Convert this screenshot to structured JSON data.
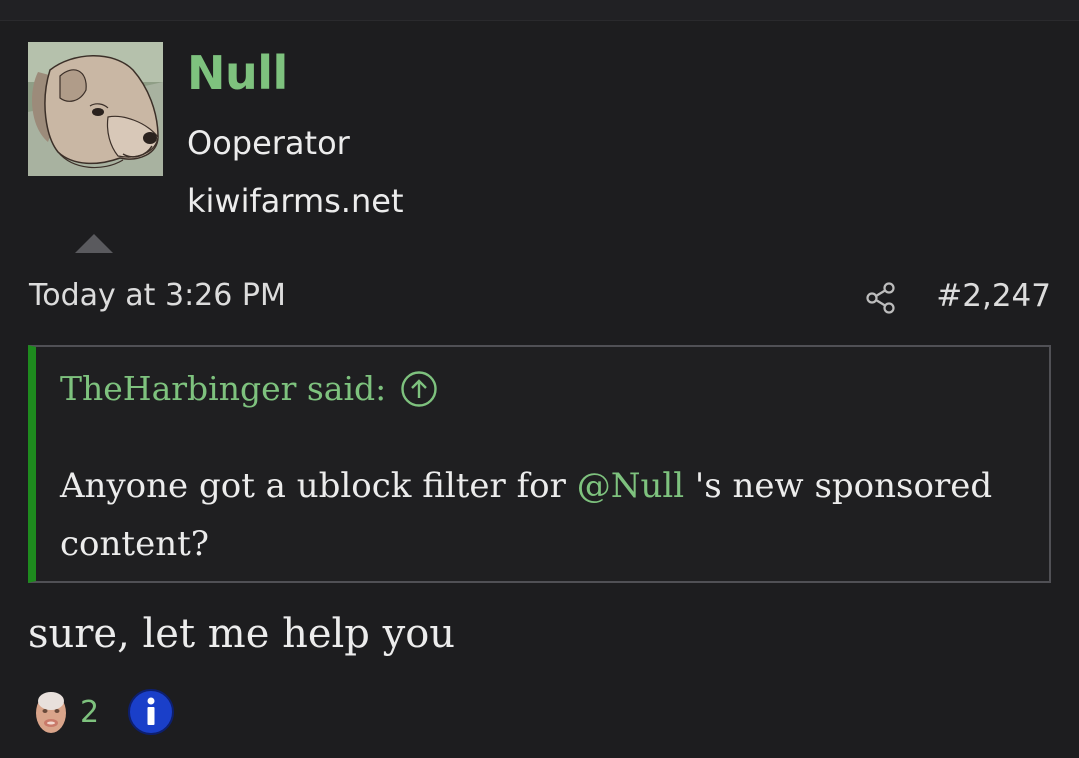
{
  "post": {
    "author": {
      "name": "Null",
      "title": "Ooperator",
      "site": "kiwifarms.net",
      "avatar_icon": "dog-avatar-icon"
    },
    "date": "Today at 3:26 PM",
    "number": "#2,247",
    "share_icon": "share-icon",
    "quote": {
      "author_said": "TheHarbinger said:",
      "jump_icon": "arrow-up-circle-icon",
      "text_before": "Anyone got a ublock filter for ",
      "mention": "@Null",
      "text_after": " 's new sponsored content?"
    },
    "body": "sure, let me help you",
    "reactions": {
      "face_icon": "reaction-face-icon",
      "count": "2",
      "info_icon": "info-icon"
    }
  },
  "colors": {
    "accent_green": "#7ec27e",
    "quote_bar": "#1e8a1e",
    "background": "#1d1d1f",
    "text": "#ececec",
    "info_blue": "#1a3fc9"
  }
}
